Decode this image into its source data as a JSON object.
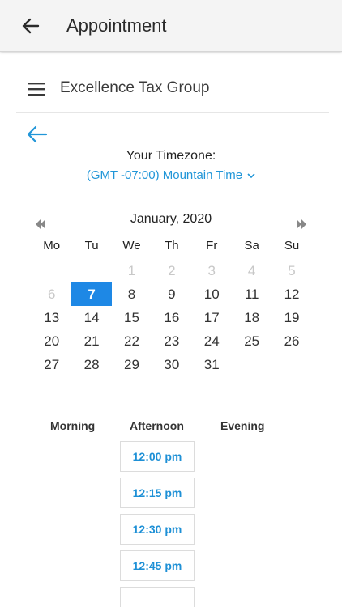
{
  "appbar": {
    "title": "Appointment"
  },
  "business": {
    "name": "Excellence Tax Group"
  },
  "timezone": {
    "label": "Your Timezone:",
    "value": "(GMT -07:00) Mountain Time"
  },
  "calendar": {
    "month_label": "January, 2020",
    "weekdays": [
      "Mo",
      "Tu",
      "We",
      "Th",
      "Fr",
      "Sa",
      "Su"
    ],
    "weeks": [
      [
        {
          "d": "",
          "s": "empty"
        },
        {
          "d": "",
          "s": "empty"
        },
        {
          "d": "1",
          "s": "muted"
        },
        {
          "d": "2",
          "s": "muted"
        },
        {
          "d": "3",
          "s": "muted"
        },
        {
          "d": "4",
          "s": "muted"
        },
        {
          "d": "5",
          "s": "muted"
        }
      ],
      [
        {
          "d": "6",
          "s": "muted"
        },
        {
          "d": "7",
          "s": "selected"
        },
        {
          "d": "8",
          "s": "active"
        },
        {
          "d": "9",
          "s": "active"
        },
        {
          "d": "10",
          "s": "active"
        },
        {
          "d": "11",
          "s": "active"
        },
        {
          "d": "12",
          "s": "active"
        }
      ],
      [
        {
          "d": "13",
          "s": "active"
        },
        {
          "d": "14",
          "s": "active"
        },
        {
          "d": "15",
          "s": "active"
        },
        {
          "d": "16",
          "s": "active"
        },
        {
          "d": "17",
          "s": "active"
        },
        {
          "d": "18",
          "s": "active"
        },
        {
          "d": "19",
          "s": "active"
        }
      ],
      [
        {
          "d": "20",
          "s": "active"
        },
        {
          "d": "21",
          "s": "active"
        },
        {
          "d": "22",
          "s": "active"
        },
        {
          "d": "23",
          "s": "active"
        },
        {
          "d": "24",
          "s": "active"
        },
        {
          "d": "25",
          "s": "active"
        },
        {
          "d": "26",
          "s": "active"
        }
      ],
      [
        {
          "d": "27",
          "s": "active"
        },
        {
          "d": "28",
          "s": "active"
        },
        {
          "d": "29",
          "s": "active"
        },
        {
          "d": "30",
          "s": "active"
        },
        {
          "d": "31",
          "s": "active"
        },
        {
          "d": "",
          "s": "empty"
        },
        {
          "d": "",
          "s": "empty"
        }
      ]
    ]
  },
  "periods": {
    "morning": "Morning",
    "afternoon": "Afternoon",
    "evening": "Evening"
  },
  "slots": [
    "12:00 pm",
    "12:15 pm",
    "12:30 pm",
    "12:45 pm"
  ],
  "colors": {
    "accent": "#2196d8",
    "selected_day": "#1e88e5"
  },
  "icons": {
    "back": "arrow-left-icon",
    "menu": "hamburger-menu-icon",
    "prev": "double-chevron-left-icon",
    "next": "double-chevron-right-icon",
    "dropdown": "chevron-down-icon"
  }
}
